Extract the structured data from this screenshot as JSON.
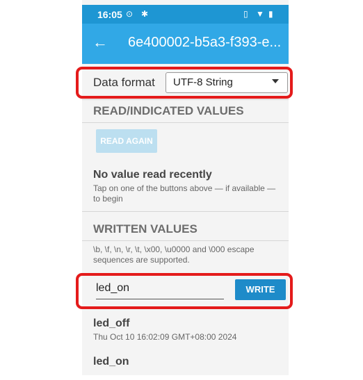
{
  "statusbar": {
    "time": "16:05",
    "icons": [
      "record-icon",
      "bluetooth-icon",
      "vibrate-icon",
      "wifi-icon",
      "battery-icon"
    ]
  },
  "appbar": {
    "title": "6e400002-b5a3-f393-e..."
  },
  "data_format": {
    "label": "Data format",
    "selected": "UTF-8 String"
  },
  "read_section": {
    "heading": "READ/INDICATED VALUES",
    "read_again": "READ AGAIN",
    "no_value_title": "No value read recently",
    "no_value_hint": "Tap on one of the buttons above — if available — to begin"
  },
  "written_section": {
    "heading": "WRITTEN VALUES",
    "escape_note": "\\b, \\f, \\n, \\r, \\t, \\x00, \\u0000 and \\000 escape sequences are supported.",
    "input_value": "led_on",
    "write_label": "WRITE",
    "history": [
      {
        "value": "led_off",
        "time": "Thu Oct 10 16:02:09 GMT+08:00 2024"
      },
      {
        "value": "led_on",
        "time": ""
      }
    ]
  },
  "colors": {
    "appbar": "#31a8e6",
    "statusbar": "#1e96d3",
    "write_button": "#1e8bc9",
    "highlight": "#e41b1b"
  }
}
